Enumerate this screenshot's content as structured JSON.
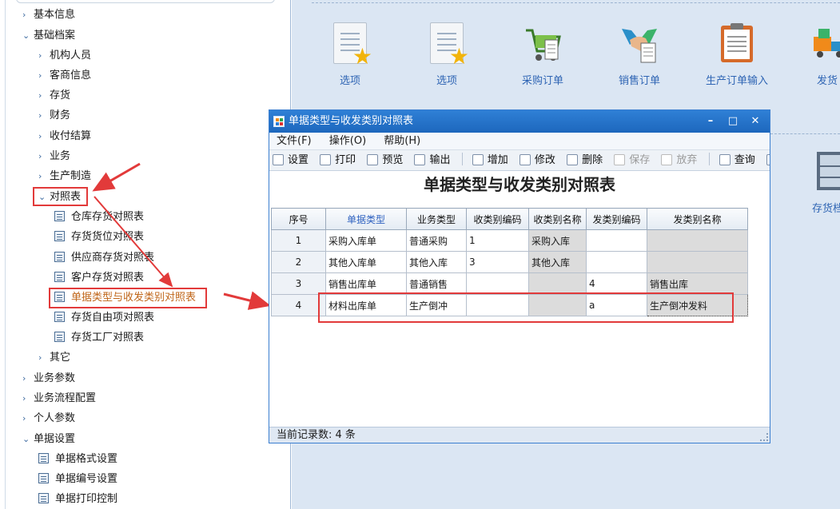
{
  "tree": {
    "items": [
      {
        "label": "基本信息",
        "arrow": "›"
      },
      {
        "label": "基础档案",
        "arrow": "⌄"
      },
      {
        "label": "机构人员",
        "arrow": "›"
      },
      {
        "label": "客商信息",
        "arrow": "›"
      },
      {
        "label": "存货",
        "arrow": "›"
      },
      {
        "label": "财务",
        "arrow": "›"
      },
      {
        "label": "收付结算",
        "arrow": "›"
      },
      {
        "label": "业务",
        "arrow": "›"
      },
      {
        "label": "生产制造",
        "arrow": "›"
      },
      {
        "label": "对照表",
        "arrow": "⌄"
      },
      {
        "label": "仓库存货对照表"
      },
      {
        "label": "存货货位对照表"
      },
      {
        "label": "供应商存货对照表"
      },
      {
        "label": "客户存货对照表"
      },
      {
        "label": "单据类型与收发类别对照表"
      },
      {
        "label": "存货自由项对照表"
      },
      {
        "label": "存货工厂对照表"
      },
      {
        "label": "其它",
        "arrow": "›"
      },
      {
        "label": "业务参数",
        "arrow": "›"
      },
      {
        "label": "业务流程配置",
        "arrow": "›"
      },
      {
        "label": "个人参数",
        "arrow": "›"
      },
      {
        "label": "单据设置",
        "arrow": "⌄"
      },
      {
        "label": "单据格式设置"
      },
      {
        "label": "单据编号设置"
      },
      {
        "label": "单据打印控制"
      }
    ]
  },
  "desktop": {
    "tiles": [
      {
        "label": "选项",
        "icon": "document-star-icon"
      },
      {
        "label": "选项",
        "icon": "document-star-icon"
      },
      {
        "label": "采购订单",
        "icon": "shopping-cart-icon"
      },
      {
        "label": "销售订单",
        "icon": "handshake-icon"
      },
      {
        "label": "生产订单输入",
        "icon": "clipboard-icon"
      },
      {
        "label": "发货",
        "icon": "truck-icon"
      },
      {
        "label": "存货档",
        "icon": "file-cabinet-icon"
      }
    ]
  },
  "window": {
    "title": "单据类型与收发类别对照表",
    "controls": {
      "minimize": "–",
      "maximize": "□",
      "close": "✕"
    },
    "menu": [
      "文件(F)",
      "操作(O)",
      "帮助(H)"
    ],
    "toolbar": {
      "setup": "设置",
      "print": "打印",
      "preview": "预览",
      "export": "输出",
      "add": "增加",
      "edit": "修改",
      "delete": "删除",
      "save": "保存",
      "discard": "放弃",
      "query": "查询",
      "more": "»"
    },
    "report_title": "单据类型与收发类别对照表",
    "table": {
      "headers": [
        "序号",
        "单据类型",
        "业务类型",
        "收类别编码",
        "收类别名称",
        "发类别编码",
        "发类别名称"
      ],
      "rows": [
        [
          "1",
          "采购入库单",
          "普通采购",
          "1",
          "采购入库",
          "",
          ""
        ],
        [
          "2",
          "其他入库单",
          "其他入库",
          "3",
          "其他入库",
          "",
          ""
        ],
        [
          "3",
          "销售出库单",
          "普通销售",
          "",
          "",
          "4",
          "销售出库"
        ],
        [
          "4",
          "材料出库单",
          "生产倒冲",
          "",
          "",
          "a",
          "生产倒冲发料"
        ]
      ]
    },
    "status": "当前记录数:  4 条"
  },
  "colors": {
    "accent": "#1d67bd",
    "highlight": "#e23a3a",
    "link": "#2f65b4"
  }
}
